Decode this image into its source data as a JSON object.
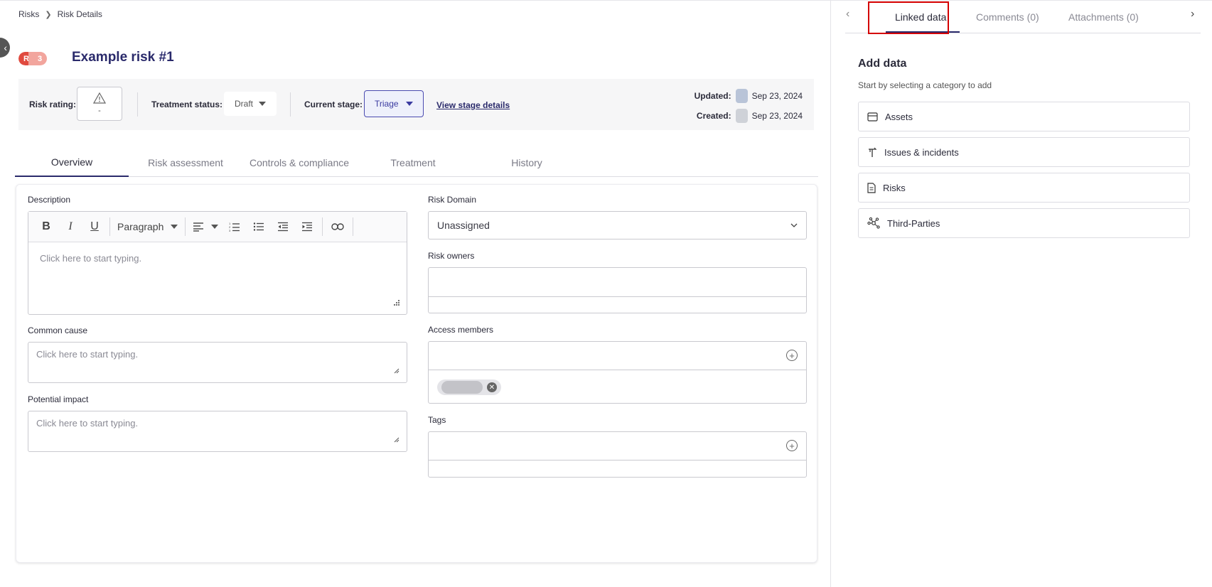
{
  "breadcrumb": {
    "root": "Risks",
    "current": "Risk Details"
  },
  "risk": {
    "badge_letter": "R",
    "badge_number": "3",
    "title": "Example risk #1"
  },
  "status_bar": {
    "risk_rating_label": "Risk rating:",
    "risk_rating_value": "-",
    "treatment_status_label": "Treatment status:",
    "treatment_status_value": "Draft",
    "current_stage_label": "Current stage:",
    "current_stage_value": "Triage",
    "view_stage_link": "View stage details",
    "updated_label": "Updated:",
    "updated_date": "Sep 23, 2024",
    "created_label": "Created:",
    "created_date": "Sep 23, 2024"
  },
  "tabs": [
    {
      "label": "Overview",
      "active": true
    },
    {
      "label": "Risk assessment",
      "active": false
    },
    {
      "label": "Controls & compliance",
      "active": false
    },
    {
      "label": "Treatment",
      "active": false
    },
    {
      "label": "History",
      "active": false
    }
  ],
  "form": {
    "description_label": "Description",
    "toolbar": {
      "bold": "B",
      "italic": "I",
      "underline": "U",
      "paragraph": "Paragraph"
    },
    "description_placeholder": "Click here to start typing.",
    "common_cause_label": "Common cause",
    "common_cause_placeholder": "Click here to start typing.",
    "potential_impact_label": "Potential impact",
    "potential_impact_placeholder": "Click here to start typing.",
    "risk_domain_label": "Risk Domain",
    "risk_domain_value": "Unassigned",
    "risk_owners_label": "Risk owners",
    "access_members_label": "Access members",
    "tags_label": "Tags"
  },
  "side_panel": {
    "tabs": [
      {
        "label": "Linked data",
        "active": true
      },
      {
        "label": "Comments (0)",
        "active": false
      },
      {
        "label": "Attachments (0)",
        "active": false
      }
    ],
    "add_title": "Add data",
    "add_subtitle": "Start by selecting a category to add",
    "categories": [
      {
        "label": "Assets",
        "icon": "box-icon"
      },
      {
        "label": "Issues & incidents",
        "icon": "issue-icon"
      },
      {
        "label": "Risks",
        "icon": "document-icon"
      },
      {
        "label": "Third-Parties",
        "icon": "network-icon"
      }
    ]
  },
  "colors": {
    "accent": "#2a2a6b",
    "badge_red": "#e04a3f",
    "highlight": "#d40000"
  }
}
